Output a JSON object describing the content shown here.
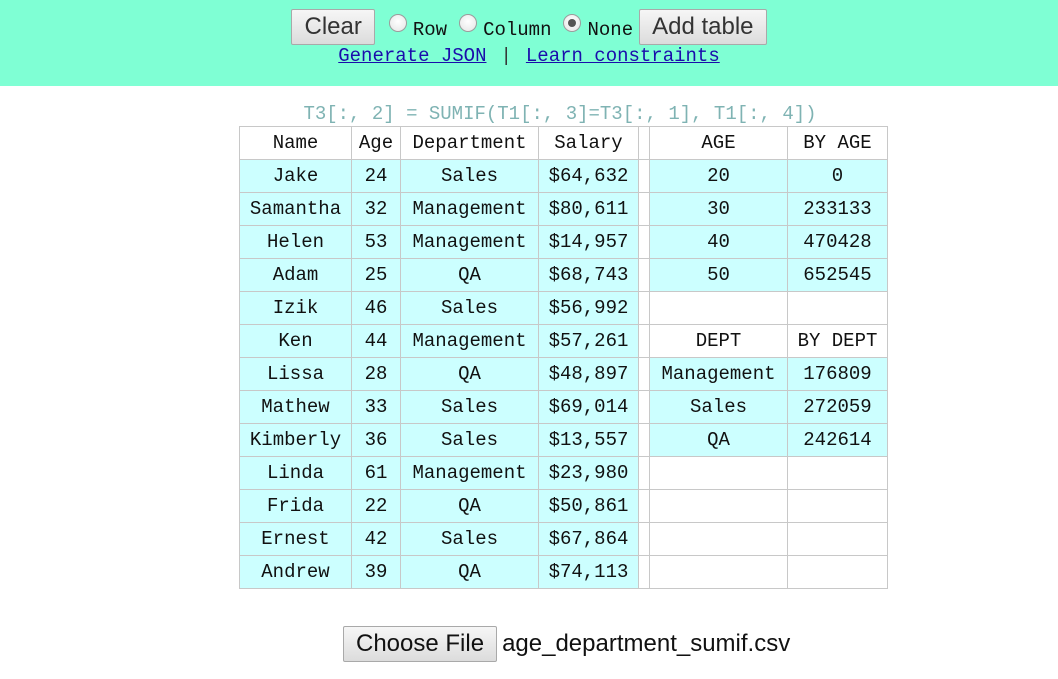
{
  "toolbar": {
    "clear_label": "Clear",
    "orientation_options": [
      {
        "label": "Row",
        "checked": false
      },
      {
        "label": "Column",
        "checked": false
      },
      {
        "label": "None",
        "checked": true
      }
    ],
    "add_table_label": "Add table"
  },
  "links": {
    "generate_json": "Generate JSON",
    "separator": "|",
    "learn_constraints": "Learn constraints"
  },
  "formula": "T3[:, 2] = SUMIF(T1[:, 3]=T3[:, 1], T1[:, 4])",
  "employees": {
    "headers": [
      "Name",
      "Age",
      "Department",
      "Salary"
    ],
    "rows": [
      [
        "Jake",
        "24",
        "Sales",
        "$64,632"
      ],
      [
        "Samantha",
        "32",
        "Management",
        "$80,611"
      ],
      [
        "Helen",
        "53",
        "Management",
        "$14,957"
      ],
      [
        "Adam",
        "25",
        "QA",
        "$68,743"
      ],
      [
        "Izik",
        "46",
        "Sales",
        "$56,992"
      ],
      [
        "Ken",
        "44",
        "Management",
        "$57,261"
      ],
      [
        "Lissa",
        "28",
        "QA",
        "$48,897"
      ],
      [
        "Mathew",
        "33",
        "Sales",
        "$69,014"
      ],
      [
        "Kimberly",
        "36",
        "Sales",
        "$13,557"
      ],
      [
        "Linda",
        "61",
        "Management",
        "$23,980"
      ],
      [
        "Frida",
        "22",
        "QA",
        "$50,861"
      ],
      [
        "Ernest",
        "42",
        "Sales",
        "$67,864"
      ],
      [
        "Andrew",
        "39",
        "QA",
        "$74,113"
      ]
    ]
  },
  "by_age": {
    "headers": [
      "AGE",
      "BY AGE"
    ],
    "rows": [
      [
        "20",
        "0"
      ],
      [
        "30",
        "233133"
      ],
      [
        "40",
        "470428"
      ],
      [
        "50",
        "652545"
      ]
    ]
  },
  "by_dept": {
    "headers": [
      "DEPT",
      "BY DEPT"
    ],
    "rows": [
      [
        "Management",
        "176809"
      ],
      [
        "Sales",
        "272059"
      ],
      [
        "QA",
        "242614"
      ]
    ]
  },
  "file": {
    "button_label": "Choose File",
    "filename": "age_department_sumif.csv"
  }
}
